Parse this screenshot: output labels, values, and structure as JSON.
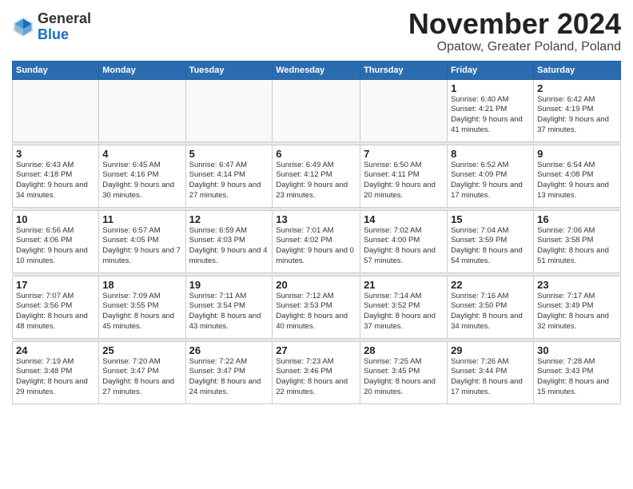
{
  "header": {
    "logo_general": "General",
    "logo_blue": "Blue",
    "month_title": "November 2024",
    "location": "Opatow, Greater Poland, Poland"
  },
  "weekdays": [
    "Sunday",
    "Monday",
    "Tuesday",
    "Wednesday",
    "Thursday",
    "Friday",
    "Saturday"
  ],
  "weeks": [
    [
      {
        "day": "",
        "info": ""
      },
      {
        "day": "",
        "info": ""
      },
      {
        "day": "",
        "info": ""
      },
      {
        "day": "",
        "info": ""
      },
      {
        "day": "",
        "info": ""
      },
      {
        "day": "1",
        "info": "Sunrise: 6:40 AM\nSunset: 4:21 PM\nDaylight: 9 hours\nand 41 minutes."
      },
      {
        "day": "2",
        "info": "Sunrise: 6:42 AM\nSunset: 4:19 PM\nDaylight: 9 hours\nand 37 minutes."
      }
    ],
    [
      {
        "day": "3",
        "info": "Sunrise: 6:43 AM\nSunset: 4:18 PM\nDaylight: 9 hours\nand 34 minutes."
      },
      {
        "day": "4",
        "info": "Sunrise: 6:45 AM\nSunset: 4:16 PM\nDaylight: 9 hours\nand 30 minutes."
      },
      {
        "day": "5",
        "info": "Sunrise: 6:47 AM\nSunset: 4:14 PM\nDaylight: 9 hours\nand 27 minutes."
      },
      {
        "day": "6",
        "info": "Sunrise: 6:49 AM\nSunset: 4:12 PM\nDaylight: 9 hours\nand 23 minutes."
      },
      {
        "day": "7",
        "info": "Sunrise: 6:50 AM\nSunset: 4:11 PM\nDaylight: 9 hours\nand 20 minutes."
      },
      {
        "day": "8",
        "info": "Sunrise: 6:52 AM\nSunset: 4:09 PM\nDaylight: 9 hours\nand 17 minutes."
      },
      {
        "day": "9",
        "info": "Sunrise: 6:54 AM\nSunset: 4:08 PM\nDaylight: 9 hours\nand 13 minutes."
      }
    ],
    [
      {
        "day": "10",
        "info": "Sunrise: 6:56 AM\nSunset: 4:06 PM\nDaylight: 9 hours\nand 10 minutes."
      },
      {
        "day": "11",
        "info": "Sunrise: 6:57 AM\nSunset: 4:05 PM\nDaylight: 9 hours\nand 7 minutes."
      },
      {
        "day": "12",
        "info": "Sunrise: 6:59 AM\nSunset: 4:03 PM\nDaylight: 9 hours\nand 4 minutes."
      },
      {
        "day": "13",
        "info": "Sunrise: 7:01 AM\nSunset: 4:02 PM\nDaylight: 9 hours\nand 0 minutes."
      },
      {
        "day": "14",
        "info": "Sunrise: 7:02 AM\nSunset: 4:00 PM\nDaylight: 8 hours\nand 57 minutes."
      },
      {
        "day": "15",
        "info": "Sunrise: 7:04 AM\nSunset: 3:59 PM\nDaylight: 8 hours\nand 54 minutes."
      },
      {
        "day": "16",
        "info": "Sunrise: 7:06 AM\nSunset: 3:58 PM\nDaylight: 8 hours\nand 51 minutes."
      }
    ],
    [
      {
        "day": "17",
        "info": "Sunrise: 7:07 AM\nSunset: 3:56 PM\nDaylight: 8 hours\nand 48 minutes."
      },
      {
        "day": "18",
        "info": "Sunrise: 7:09 AM\nSunset: 3:55 PM\nDaylight: 8 hours\nand 45 minutes."
      },
      {
        "day": "19",
        "info": "Sunrise: 7:11 AM\nSunset: 3:54 PM\nDaylight: 8 hours\nand 43 minutes."
      },
      {
        "day": "20",
        "info": "Sunrise: 7:12 AM\nSunset: 3:53 PM\nDaylight: 8 hours\nand 40 minutes."
      },
      {
        "day": "21",
        "info": "Sunrise: 7:14 AM\nSunset: 3:52 PM\nDaylight: 8 hours\nand 37 minutes."
      },
      {
        "day": "22",
        "info": "Sunrise: 7:16 AM\nSunset: 3:50 PM\nDaylight: 8 hours\nand 34 minutes."
      },
      {
        "day": "23",
        "info": "Sunrise: 7:17 AM\nSunset: 3:49 PM\nDaylight: 8 hours\nand 32 minutes."
      }
    ],
    [
      {
        "day": "24",
        "info": "Sunrise: 7:19 AM\nSunset: 3:48 PM\nDaylight: 8 hours\nand 29 minutes."
      },
      {
        "day": "25",
        "info": "Sunrise: 7:20 AM\nSunset: 3:47 PM\nDaylight: 8 hours\nand 27 minutes."
      },
      {
        "day": "26",
        "info": "Sunrise: 7:22 AM\nSunset: 3:47 PM\nDaylight: 8 hours\nand 24 minutes."
      },
      {
        "day": "27",
        "info": "Sunrise: 7:23 AM\nSunset: 3:46 PM\nDaylight: 8 hours\nand 22 minutes."
      },
      {
        "day": "28",
        "info": "Sunrise: 7:25 AM\nSunset: 3:45 PM\nDaylight: 8 hours\nand 20 minutes."
      },
      {
        "day": "29",
        "info": "Sunrise: 7:26 AM\nSunset: 3:44 PM\nDaylight: 8 hours\nand 17 minutes."
      },
      {
        "day": "30",
        "info": "Sunrise: 7:28 AM\nSunset: 3:43 PM\nDaylight: 8 hours\nand 15 minutes."
      }
    ]
  ]
}
